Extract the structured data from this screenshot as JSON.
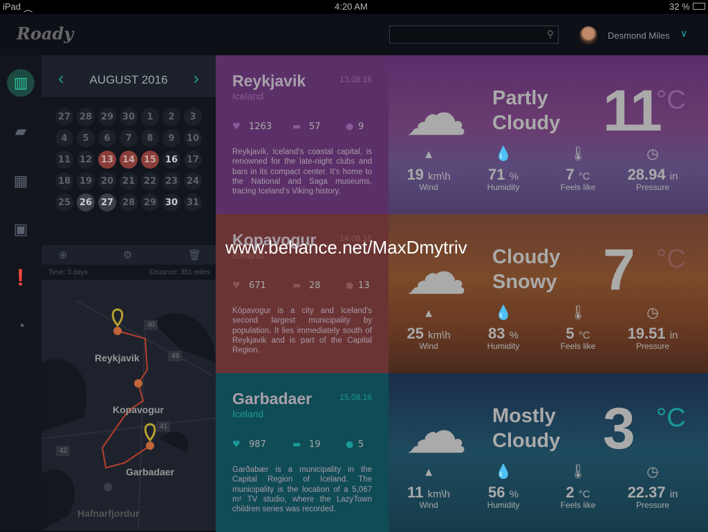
{
  "status": {
    "device": "iPad",
    "time": "4:20 AM",
    "battery": "32 %"
  },
  "header": {
    "logo": "Roady",
    "search_placeholder": "",
    "user": "Desmond Miles"
  },
  "sidebar": [
    "map-icon",
    "chat-icon",
    "calendar-icon",
    "photos-icon",
    "alert-icon",
    "pie-chart-icon"
  ],
  "calendar": {
    "month": "AUGUST 2016",
    "days": [
      "27",
      "28",
      "29",
      "30",
      "1",
      "2",
      "3",
      "4",
      "5",
      "6",
      "7",
      "8",
      "9",
      "10",
      "11",
      "12",
      "13",
      "14",
      "15",
      "16",
      "17",
      "18",
      "19",
      "20",
      "21",
      "22",
      "23",
      "24",
      "25",
      "26",
      "27",
      "28",
      "29",
      "30",
      "31"
    ],
    "selected": [
      16,
      17,
      18
    ],
    "bold": [
      19,
      33
    ],
    "highlighted": [
      29,
      30
    ],
    "time": "Time: 3 days",
    "distance": "Distance: 351 miles"
  },
  "map": {
    "places": [
      "Reykjavik",
      "Kopavogur",
      "Garbadaer",
      "Hafnarfjordur"
    ],
    "roads": [
      "40",
      "49",
      "41",
      "42"
    ]
  },
  "cities": [
    {
      "name": "Reykjavik",
      "country": "Iceland",
      "date": "13.08.16",
      "likes": "1263",
      "comments": "57",
      "alerts": "9",
      "desc": "Reykjavik, Iceland’s coastal capital, is renowned for the late-night clubs and bars in its compact center. It’s home to the National and Saga museums, tracing Iceland’s Viking history.",
      "color": "#5b3068",
      "accent": "#8a5a98",
      "weather": {
        "condition1": "Partly",
        "condition2": "Cloudy",
        "temp": "11",
        "unit": "°C",
        "wind": "19",
        "wind_unit": "km\\h",
        "humidity": "71",
        "hum_unit": "%",
        "feels": "7",
        "feels_unit": "°C",
        "pressure": "28.94",
        "press_unit": "in",
        "bg": "linear-gradient(180deg,#5a2e6a,#6a3c70 45%,#5a4a7a 70%,#4a3c66)"
      }
    },
    {
      "name": "Kopavogur",
      "country": "Iceland",
      "date": "14.08.16",
      "likes": "671",
      "comments": "28",
      "alerts": "13",
      "desc": "Kópavogur is a city and Iceland's second largest municipality by population. It lies immediately south of Reykjavik and is part of the Capital Region.",
      "color": "#6b3434",
      "accent": "#8a5555",
      "weather": {
        "condition1": "Cloudy",
        "condition2": "Snowy",
        "temp": "7",
        "unit": "°C",
        "wind": "25",
        "wind_unit": "km\\h",
        "humidity": "83",
        "hum_unit": "%",
        "feels": "5",
        "feels_unit": "°C",
        "pressure": "19.51",
        "press_unit": "in",
        "bg": "linear-gradient(180deg,#6a3e30,#7a4a2a 40%,#6a3a22 70%,#4a2a1e)"
      }
    },
    {
      "name": "Garbadaer",
      "country": "Iceland",
      "date": "15.08.16",
      "likes": "987",
      "comments": "19",
      "alerts": "5",
      "desc": "Garðabær is a municipality in the Capital Region of Iceland. The municipality is the location of a 5,067 m² TV studio, where the LazyTown children series was recorded.",
      "color": "#0f4c55",
      "accent": "#1a9a9a",
      "weather": {
        "condition1": "Mostly",
        "condition2": "Cloudy",
        "temp": "3",
        "unit": "°C",
        "wind": "11",
        "wind_unit": "km\\h",
        "humidity": "56",
        "hum_unit": "%",
        "feels": "2",
        "feels_unit": "°C",
        "pressure": "22.37",
        "press_unit": "in",
        "bg": "linear-gradient(180deg,#1a2e4a,#1e4a5e 50%,#163c4a)"
      }
    }
  ],
  "labels": {
    "wind": "Wind",
    "humidity": "Humidity",
    "feels": "Feels like",
    "pressure": "Pressure"
  },
  "watermark": "www.behance.net/MaxDmytriv"
}
